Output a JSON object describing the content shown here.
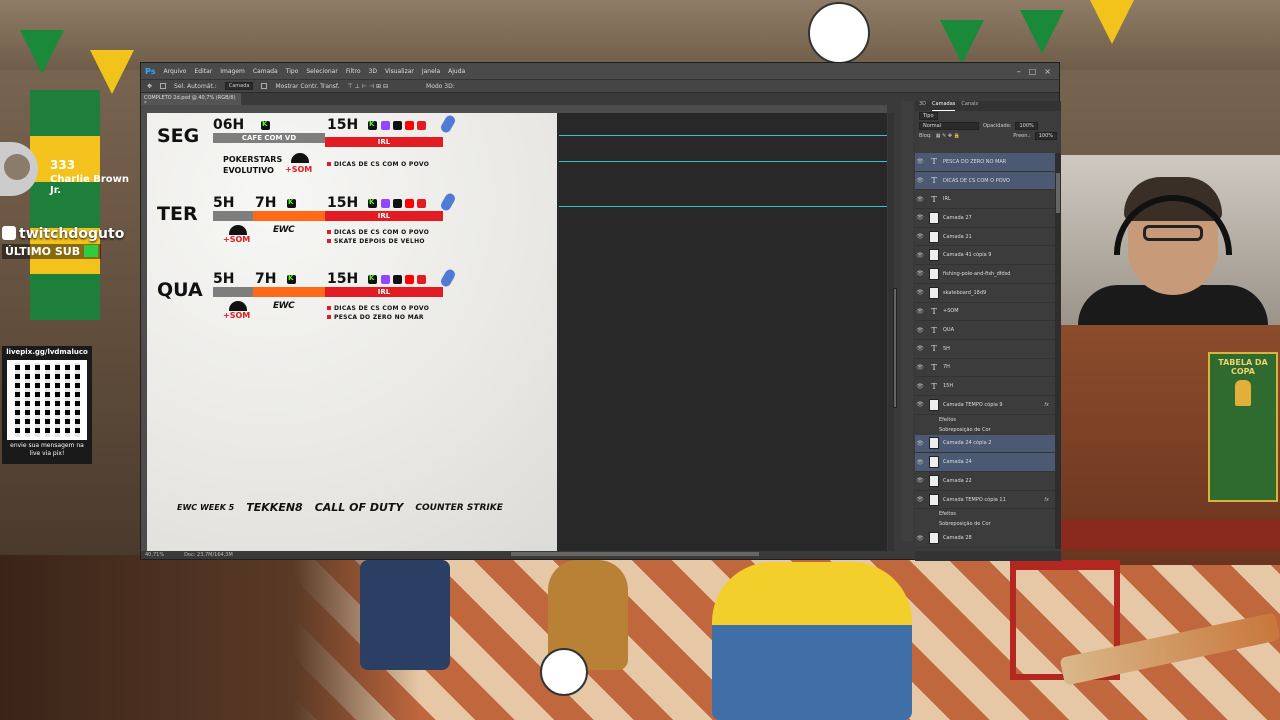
{
  "stream": {
    "sub_count": "333",
    "sub_name": "Charlie Brown Jr.",
    "handle": "twitchdoguto",
    "ultimo_sub": "ÚLTIMO SUB",
    "qr_url": "livepix.gg/lvdmaluco",
    "qr_caption_1": "envie sua mensagem na",
    "qr_caption_2": "live via pix!",
    "copa_label": "TABELA DA COPA"
  },
  "photoshop": {
    "logo": "Ps",
    "menu": [
      "Arquivo",
      "Editar",
      "Imagem",
      "Camada",
      "Tipo",
      "Selecionar",
      "Filtro",
      "3D",
      "Visualizar",
      "Janela",
      "Ajuda"
    ],
    "options": {
      "auto_select_label": "Sel. Automát.:",
      "auto_select_value": "Camada",
      "transform_label": "Mostrar Contr. Transf.",
      "mode_3d": "Modo 3D:"
    },
    "document_tab": "COMPLETO 2d.psd @ 40,7% (RGB/8) *",
    "status": {
      "zoom": "40,71%",
      "doc": "Doc: 23,7M/164,3M"
    }
  },
  "poster": {
    "days": [
      {
        "day": "SEG",
        "slot1": "06H",
        "slot1_sub": "CAFE COM VD",
        "main": "15H",
        "main_sub": "IRL",
        "pokerstars": "POKERSTARS",
        "evolutivo": "EVOLUTIVO",
        "som": "+SOM",
        "lines": [
          "DICAS DE CS COM O POVO"
        ]
      },
      {
        "day": "TER",
        "slot1": "5H",
        "slot2": "7H",
        "main": "15H",
        "main_sub": "IRL",
        "som": "+SOM",
        "lines": [
          "DICAS DE CS COM O POVO",
          "SKATE DEPOIS DE VELHO"
        ]
      },
      {
        "day": "QUA",
        "slot1": "5H",
        "slot2": "7H",
        "main": "15H",
        "main_sub": "IRL",
        "som": "+SOM",
        "lines": [
          "DICAS DE CS COM O POVO",
          "PESCA DO ZERO NO MAR"
        ]
      }
    ],
    "ewc": "EWC",
    "logos": [
      "EWC WEEK 5",
      "TEKKEN8",
      "CALL OF DUTY",
      "COUNTER STRIKE"
    ]
  },
  "layers_panel": {
    "tabs": [
      "3D",
      "Camadas",
      "Canais"
    ],
    "filter": "Tipo",
    "blend_mode": "Normal",
    "opacity_label": "Opacidade:",
    "opacity_value": "100%",
    "lock_label": "Bloq:",
    "fill_label": "Preen.:",
    "fill_value": "100%",
    "layers": [
      {
        "name": "PESCA DO ZERO NO MAR",
        "type": "text",
        "selected": true
      },
      {
        "name": "DICAS DE CS COM O POVO",
        "type": "text",
        "selected": true
      },
      {
        "name": "IRL",
        "type": "text",
        "selected": false
      },
      {
        "name": "Camada 27",
        "type": "image",
        "selected": false
      },
      {
        "name": "Camada 21",
        "type": "image",
        "selected": false
      },
      {
        "name": "Camada 41 cópia 9",
        "type": "image",
        "selected": false
      },
      {
        "name": "fishing-pole-and-fish_dfdsd",
        "type": "image",
        "selected": false
      },
      {
        "name": "skateboard_18d9",
        "type": "image",
        "selected": false
      },
      {
        "name": "+SOM",
        "type": "text",
        "selected": false
      },
      {
        "name": "QUA",
        "type": "text",
        "selected": false
      },
      {
        "name": "5H",
        "type": "text",
        "selected": false
      },
      {
        "name": "7H",
        "type": "text",
        "selected": false
      },
      {
        "name": "15H",
        "type": "text",
        "selected": false
      },
      {
        "name": "Camada TEMPO cópia 9",
        "type": "image",
        "selected": false,
        "fx": "fx"
      },
      {
        "name": "Efeitos",
        "type": "sub",
        "selected": false
      },
      {
        "name": "Sobreposição de Cor",
        "type": "sub",
        "selected": false
      },
      {
        "name": "Camada 24 cópia 2",
        "type": "image",
        "selected": true
      },
      {
        "name": "Camada 24",
        "type": "image",
        "selected": true
      },
      {
        "name": "Camada 22",
        "type": "image",
        "selected": false
      },
      {
        "name": "Camada TEMPO cópia 11",
        "type": "image",
        "selected": false,
        "fx": "fx"
      },
      {
        "name": "Efeitos",
        "type": "sub",
        "selected": false
      },
      {
        "name": "Sobreposição de Cor",
        "type": "sub",
        "selected": false
      },
      {
        "name": "Camada 28",
        "type": "image",
        "selected": false
      }
    ]
  },
  "colors": {
    "brand_red": "#e31b23",
    "brand_orange": "#ff6a19",
    "kick_green": "#53fc18",
    "guide_cyan": "#32c8c8",
    "ps_accent": "#31a8ff"
  }
}
